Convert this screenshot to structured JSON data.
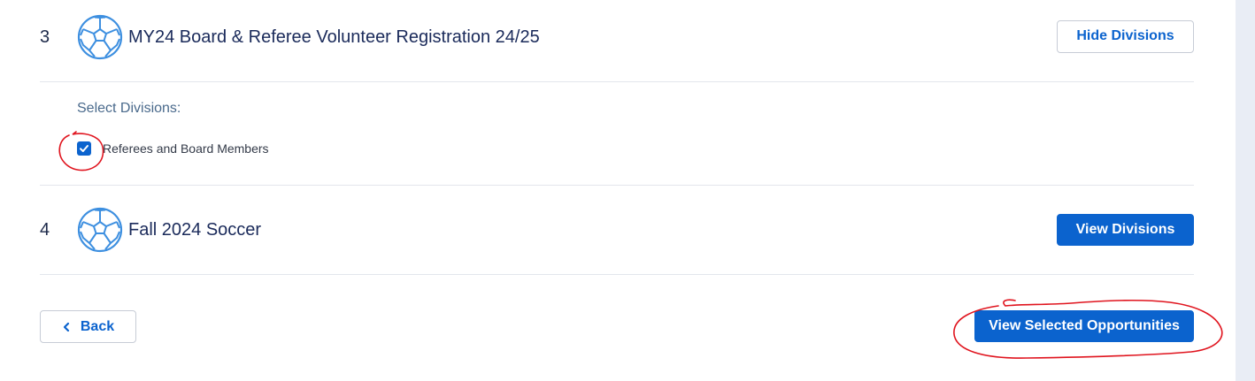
{
  "rows": [
    {
      "number": "3",
      "title": "MY24 Board & Referee Volunteer Registration 24/25",
      "button": "Hide Divisions"
    },
    {
      "number": "4",
      "title": "Fall 2024 Soccer",
      "button": "View Divisions"
    }
  ],
  "divisions": {
    "label": "Select Divisions:",
    "options": [
      {
        "label": "Referees and Board Members",
        "checked": true
      }
    ]
  },
  "footer": {
    "back_label": "Back",
    "view_selected_label": "View Selected Opportunities"
  },
  "colors": {
    "accent": "#0b63ce",
    "title_text": "#1a2a5a",
    "annotation": "#e0141e"
  },
  "icons": [
    "soccer-ball-icon",
    "checkmark-icon",
    "chevron-left-icon"
  ]
}
